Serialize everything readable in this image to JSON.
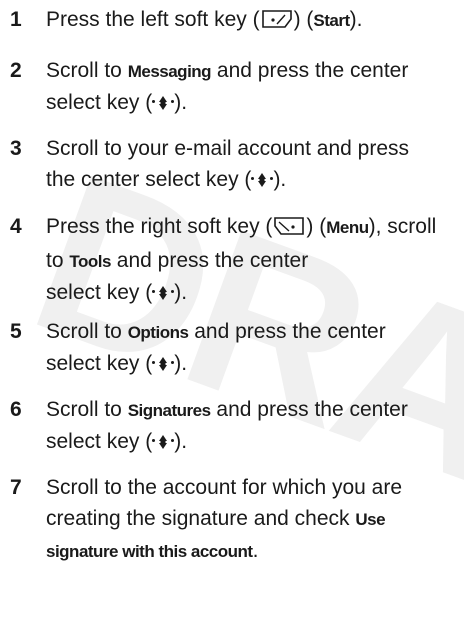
{
  "watermark": "DRAFT",
  "icons": {
    "left_soft_key": "left-soft-key-icon",
    "right_soft_key": "right-soft-key-icon",
    "center_select_key": "center-select-key-icon"
  },
  "steps": [
    {
      "num": "1",
      "a": "Press the left soft key (",
      "b": ") (",
      "c": "Start",
      "d": ")."
    },
    {
      "num": "2",
      "a": "Scroll to ",
      "b": "Messaging",
      "c": " and press the center",
      "d": "select key (",
      "e": ")."
    },
    {
      "num": "3",
      "a": "Scroll to your e-mail account and press",
      "b": "the center select key (",
      "c": ")."
    },
    {
      "num": "4",
      "a": "Press the right soft key (",
      "b": ") (",
      "c": "Menu",
      "d": "), scroll",
      "e": "to ",
      "f": "Tools",
      "g": " and press the center",
      "h": "select key (",
      "i": ")."
    },
    {
      "num": "5",
      "a": "Scroll to ",
      "b": "Options",
      "c": " and press the center",
      "d": "select key (",
      "e": ")."
    },
    {
      "num": "6",
      "a": "Scroll to ",
      "b": "Signatures",
      "c": " and press the center",
      "d": "select key (",
      "e": ")."
    },
    {
      "num": "7",
      "a": "Scroll to the account for which you are",
      "b": "creating the signature and check ",
      "c": "Use",
      "d": "signature with this account",
      "e": "."
    }
  ]
}
